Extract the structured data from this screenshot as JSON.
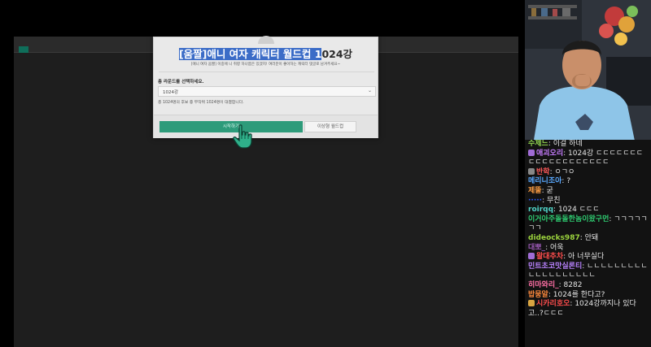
{
  "modal": {
    "title_highlight": "[움짤]애니 여자 캐릭터 월드컵 1",
    "title_rest": "024강",
    "subtitle": "[애니 여자 움짤] 이중에 니 취향 하나쯤은 있겠지!  여러분이 좋아하는 캐릭터 댓글로 남겨주세요~",
    "round_label": "총 라운드를 선택하세요.",
    "round_selected": "1024강",
    "round_caret": "⌄",
    "round_note": "총 1024명의 후보 중 무작위 1024명이 대결합니다.",
    "start_label": "시작하기",
    "ideal_label": "이상형 월드컵"
  },
  "colors": {
    "accent": "#2d9b7a",
    "highlight": "#3b6cc7",
    "chat_bg": "#121212"
  },
  "chat": {
    "messages": [
      {
        "nick": "수제느",
        "nick_color": "#8fd14f",
        "text": "이걸 하네",
        "badge": ""
      },
      {
        "nick": "애괴오리",
        "nick_color": "#c77dff",
        "text": "1024강 ㄷㄷㄷㄷㄷㄷㄷㄷㄷㄷㄷㄷㄷㄷㄷㄷㄷㄷㄷ",
        "badge": "#a06cd5"
      },
      {
        "nick": "반학",
        "nick_color": "#ff5a5a",
        "text": "ㅇㄱㅇ",
        "badge": "#888888"
      },
      {
        "nick": "메리니조아",
        "nick_color": "#5aa9ff",
        "text": "?",
        "badge": ""
      },
      {
        "nick": "제뚤",
        "nick_color": "#ff9f43",
        "text": "굳",
        "badge": ""
      },
      {
        "nick": "·····",
        "nick_color": "#2b59ff",
        "text": "무친",
        "badge": ""
      },
      {
        "nick": "roirqq",
        "nick_color": "#4fd1c5",
        "text": "1024 ㄷㄷㄷ",
        "badge": ""
      },
      {
        "nick": "이거아주돌돌한놈이왔구먼",
        "nick_color": "#2ecc71",
        "text": "ㄱㄱㄱㄱㄱㄱㄱ",
        "badge": ""
      },
      {
        "nick": "dideocks987",
        "nick_color": "#9bd33d",
        "text": "안돼",
        "badge": ""
      },
      {
        "nick": "대뽀_",
        "nick_color": "#9b59b6",
        "text": "어욱",
        "badge": ""
      },
      {
        "nick": "왈대추차",
        "nick_color": "#ff4d4d",
        "text": "아 너무실다",
        "badge": "#a06cd5"
      },
      {
        "nick": "민트초코맛실론티",
        "nick_color": "#b983ff",
        "text": "ㄴㄴㄴㄴㄴㄴㄴㄴㄴㄴㄴㄴㄴㄴㄴㄴㄴㄴㄴ",
        "badge": ""
      },
      {
        "nick": "히마와리_",
        "nick_color": "#ff6fa5",
        "text": "8282",
        "badge": ""
      },
      {
        "nick": "밥뭉알",
        "nick_color": "#ff8a3d",
        "text": "1024를 한다고?",
        "badge": ""
      },
      {
        "nick": "시카리호오",
        "nick_color": "#ff4d4d",
        "text": "1024강까지나 있다고..?ㄷㄷㄷ",
        "badge": "#d9a441"
      }
    ]
  }
}
